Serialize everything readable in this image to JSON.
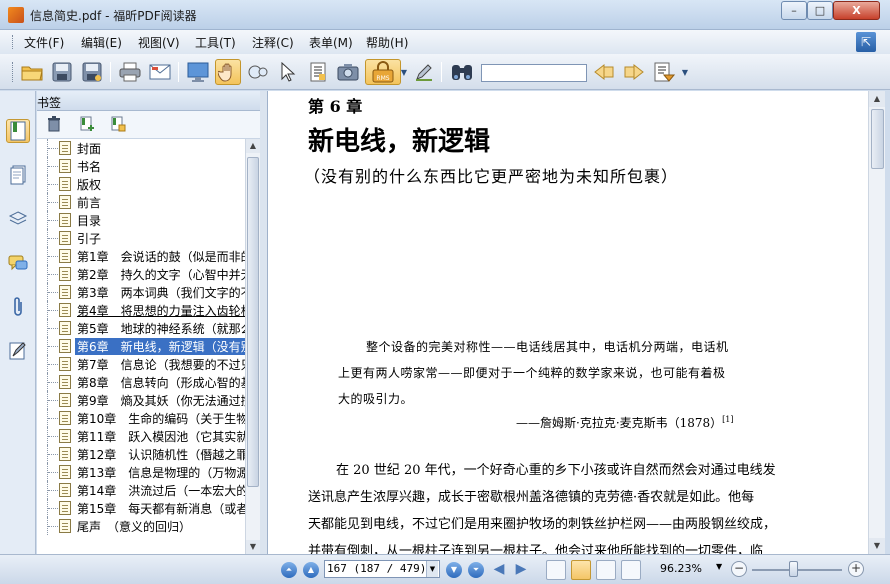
{
  "window": {
    "title": "信息简史.pdf - 福昕PDF阅读器",
    "minimize": "–",
    "maximize": "□",
    "close": "X"
  },
  "menu": {
    "items": [
      "文件(F)",
      "编辑(E)",
      "视图(V)",
      "工具(T)",
      "注释(C)",
      "表单(M)",
      "帮助(H)"
    ]
  },
  "toolbar": {
    "search_value": ""
  },
  "bookmarks": {
    "panel_title": "书签",
    "items": [
      "封面",
      "书名",
      "版权",
      "前言",
      "目录",
      "引子",
      "第1章　会说话的鼓（似是而非的",
      "第2章　持久的文字（心智中并无",
      "第3章　两本词典（我们文字的不",
      "第4章　将思想的力量注入齿轮机",
      "第5章　地球的神经系统（就那么",
      "第6章　新电线，新逻辑（没有别",
      "第7章　信息论（我想要的不过只",
      "第8章　信息转向（形成心智的基",
      "第9章　熵及其妖（你无法通过搅",
      "第10章　生命的编码（关于生物体",
      "第11章　跃入模因池（它其实就",
      "第12章　认识随机性（僭越之罪",
      "第13章　信息是物理的（万物源",
      "第14章　洪流过后（一本宏大的",
      "第15章　每天都有新消息（或者",
      "尾声　（意义的回归）"
    ],
    "selected_index": 11,
    "underlined_index": 9
  },
  "document": {
    "chapter_no": "第 6 章",
    "chapter_title": "新电线，新逻辑",
    "chapter_subtitle": "（没有别的什么东西比它更严密地为未知所包裹）",
    "quote_lines": [
      "整个设备的完美对称性——电话线居其中，电话机分两端，电话机",
      "上更有两人唠家常——即便对于一个纯粹的数学家来说，也可能有着极",
      "大的吸引力。"
    ],
    "quote_attribution": "——詹姆斯·克拉克·麦克斯韦（1878）",
    "quote_ref": "[1]",
    "body_lines": [
      "在 20 世纪 20 年代，一个好奇心重的乡下小孩或许自然而然会对通过电线发",
      "送讯息产生浓厚兴趣，成长于密歇根州盖洛德镇的克劳德·香农就是如此。他每",
      "天都能见到电线，不过它们是用来圈护牧场的刺铁丝护栏网——由两股钢丝绞成，",
      "并带有倒刺，从一根柱子连到另一根柱子。他会过来他所能找到的一切零件，临"
    ]
  },
  "status": {
    "page_indicator": "167 (187 / 479)",
    "zoom": "96.23%"
  },
  "colors": {
    "selection": "#3a70c4",
    "chrome": "#cfdcec"
  }
}
